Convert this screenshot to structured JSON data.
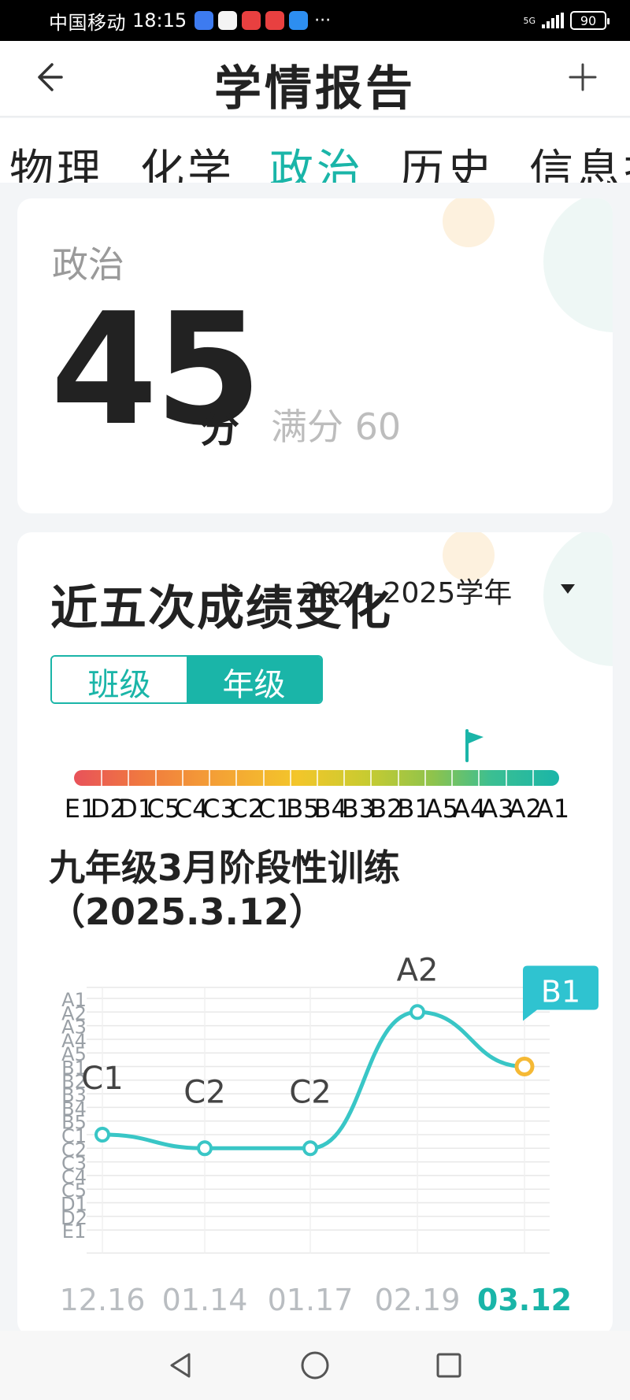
{
  "status_bar": {
    "carrier": "中国移动",
    "time": "18:15",
    "more": "···",
    "network": "5G",
    "battery": "90"
  },
  "header": {
    "title": "学情报告",
    "back_icon": "arrow-left-icon",
    "add_icon": "plus-icon"
  },
  "tabs": [
    {
      "label": "物理",
      "active": false
    },
    {
      "label": "化学",
      "active": false
    },
    {
      "label": "政治",
      "active": true
    },
    {
      "label": "历史",
      "active": false
    },
    {
      "label": "信息技",
      "active": false
    }
  ],
  "score_card": {
    "subject": "政治",
    "score": "45",
    "unit": "分",
    "full_marks": "满分 60"
  },
  "trend_card": {
    "title": "近五次成绩变化",
    "school_year": "2024-2025学年",
    "toggle": {
      "class_label": "班级",
      "grade_label": "年级",
      "selected": "年级"
    },
    "grade_scale": [
      "E1",
      "D2",
      "D1",
      "C5",
      "C4",
      "C3",
      "C2",
      "C1",
      "B5",
      "B4",
      "B3",
      "B2",
      "B1",
      "A5",
      "A4",
      "A3",
      "A2",
      "A1"
    ],
    "current_grade_flag": "B1",
    "exam_name": "九年级3月阶段性训练（2025.3.12）"
  },
  "chart_data": {
    "type": "line",
    "y_categories": [
      "A1",
      "A2",
      "A3",
      "A4",
      "A5",
      "B1",
      "B2",
      "B3",
      "B4",
      "B5",
      "C1",
      "C2",
      "C3",
      "C4",
      "C5",
      "D1",
      "D2",
      "E1"
    ],
    "x": [
      "12.16",
      "01.14",
      "01.17",
      "02.19",
      "03.12"
    ],
    "values": [
      "C1",
      "C2",
      "C2",
      "A2",
      "B1"
    ],
    "highlight_index": 4,
    "colors": {
      "line": "#39c6c6",
      "point": "#39c6c6",
      "highlight_point": "#f5b935",
      "highlight_label_bg": "#2fc3d0",
      "highlight_x_label": "#1ab5a8",
      "grid": "#e8e8e8"
    }
  },
  "nav_bar": {
    "icons": [
      "back-triangle-icon",
      "home-circle-icon",
      "recents-square-icon"
    ]
  },
  "colors": {
    "accent": "#1ab5a8",
    "card_bg": "#ffffff",
    "page_bg": "#f3f5f7"
  }
}
